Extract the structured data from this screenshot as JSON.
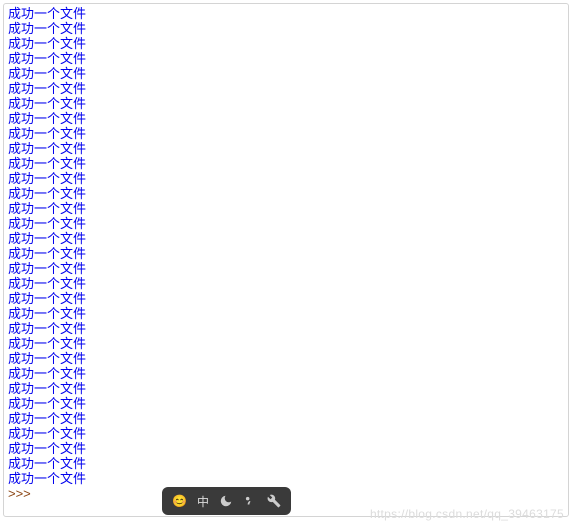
{
  "console": {
    "output_text": "成功一个文件",
    "output_count": 32,
    "prompt": ">>>"
  },
  "ime": {
    "lang_label": "中"
  },
  "watermark": "https://blog.csdn.net/qq_39463175"
}
